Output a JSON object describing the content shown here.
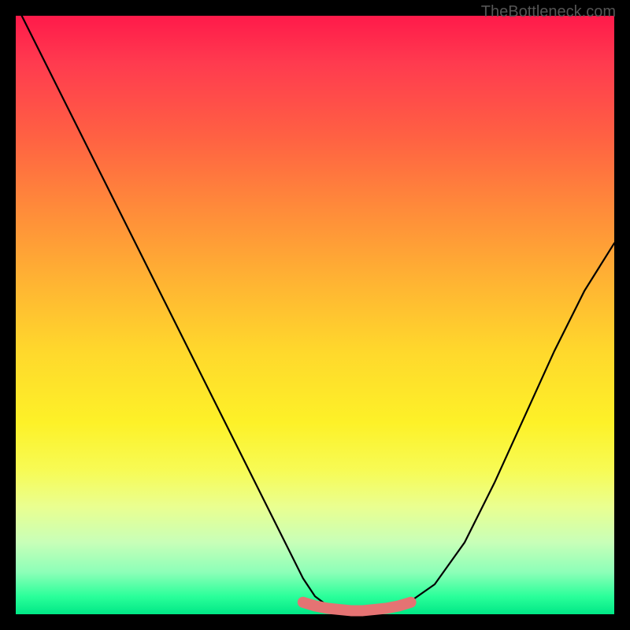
{
  "watermark": "TheBottleneck.com",
  "chart_data": {
    "type": "line",
    "title": "",
    "xlabel": "",
    "ylabel": "",
    "xlim": [
      0,
      100
    ],
    "ylim": [
      0,
      100
    ],
    "series": [
      {
        "name": "bottleneck-curve",
        "x": [
          0,
          5,
          10,
          15,
          20,
          25,
          30,
          35,
          40,
          45,
          48,
          50,
          52,
          55,
          58,
          60,
          63,
          65,
          70,
          75,
          80,
          85,
          90,
          95,
          100
        ],
        "y": [
          102,
          92,
          82,
          72,
          62,
          52,
          42,
          32,
          22,
          12,
          6,
          3,
          1.5,
          0.8,
          0.5,
          0.5,
          0.8,
          1.5,
          5,
          12,
          22,
          33,
          44,
          54,
          62
        ]
      },
      {
        "name": "optimal-marker",
        "x": [
          48,
          50,
          52,
          54,
          56,
          58,
          60,
          62,
          64,
          66
        ],
        "y": [
          2.0,
          1.4,
          1.0,
          0.8,
          0.6,
          0.6,
          0.8,
          1.0,
          1.4,
          2.0
        ]
      }
    ],
    "gradient_stops": [
      {
        "pos": 0,
        "color": "#ff1a4a"
      },
      {
        "pos": 50,
        "color": "#ffd82c"
      },
      {
        "pos": 100,
        "color": "#00e886"
      }
    ]
  }
}
